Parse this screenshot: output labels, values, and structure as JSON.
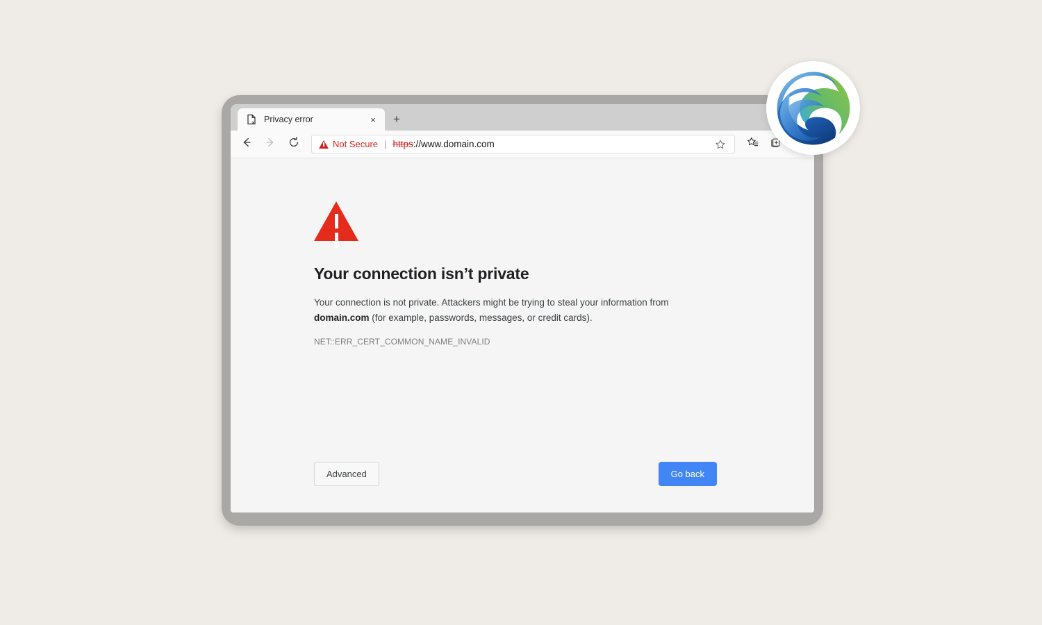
{
  "window": {
    "tab": {
      "title": "Privacy error",
      "favicon": "broken-page-icon",
      "close_label": "×"
    },
    "new_tab_label": "+",
    "controls": {
      "minimize": "minimize-icon"
    }
  },
  "toolbar": {
    "back_icon": "back-arrow-icon",
    "forward_icon": "forward-arrow-icon",
    "reload_icon": "reload-icon",
    "security": {
      "label": "Not Secure",
      "icon": "warning-triangle-icon",
      "color": "#d32020"
    },
    "separator": "|",
    "url": {
      "scheme": "https",
      "rest": "://www.domain.com"
    },
    "favorite_icon": "star-outline-icon",
    "favorites_list_icon": "favorites-list-icon",
    "collections_icon": "collections-icon",
    "profile_icon": "profile-avatar-icon"
  },
  "error_page": {
    "icon": "red-warning-triangle",
    "heading": "Your connection isn’t private",
    "body_part1": "Your connection is not private. Attackers might be trying to steal your information from ",
    "body_domain": "domain.com",
    "body_part2": " (for example, passwords, messages, or credit cards).",
    "error_code": "NET::ERR_CERT_COMMON_NAME_INVALID",
    "advanced_label": "Advanced",
    "go_back_label": "Go back"
  },
  "branding": {
    "logo": "microsoft-edge-logo"
  },
  "colors": {
    "page_background": "#efece7",
    "bezel": "#a9a8a6",
    "tab_strip": "#cfcfcf",
    "toolbar": "#fafafa",
    "content": "#f5f5f5",
    "warning_red": "#e52b1c",
    "primary_blue": "#4285f4"
  }
}
